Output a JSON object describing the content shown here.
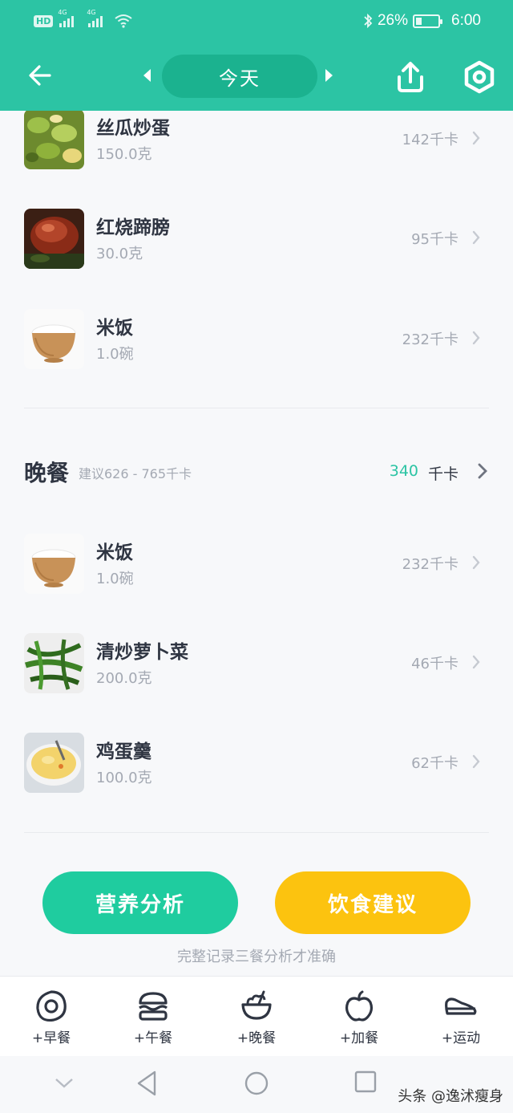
{
  "status_bar": {
    "hd": "HD",
    "net1": "4G",
    "net2": "4G",
    "battery_percent": "26%",
    "battery_level": 0.26,
    "time": "6:00"
  },
  "header": {
    "date_label": "今天",
    "back_icon": "arrow-left-icon",
    "prev_icon": "caret-left-icon",
    "next_icon": "caret-right-icon",
    "share_icon": "share-upload-icon",
    "settings_icon": "hexagon-settings-icon"
  },
  "lunch_items": [
    {
      "name": "丝瓜炒蛋",
      "qty": "150.0克",
      "kcal": "142千卡"
    },
    {
      "name": "红烧蹄膀",
      "qty": "30.0克",
      "kcal": "95千卡"
    },
    {
      "name": "米饭",
      "qty": "1.0碗",
      "kcal": "232千卡"
    }
  ],
  "dinner": {
    "title": "晚餐",
    "suggest": "建议626 - 765千卡",
    "kcal": "340",
    "kcal_unit": "千卡",
    "items": [
      {
        "name": "米饭",
        "qty": "1.0碗",
        "kcal": "232千卡"
      },
      {
        "name": "清炒萝卜菜",
        "qty": "200.0克",
        "kcal": "46千卡"
      },
      {
        "name": "鸡蛋羹",
        "qty": "100.0克",
        "kcal": "62千卡"
      }
    ]
  },
  "actions": {
    "nutrition_label": "营养分析",
    "diet_label": "饮食建议",
    "hint": "完整记录三餐分析才准确"
  },
  "tabs": [
    {
      "label": "+早餐",
      "icon": "egg-icon"
    },
    {
      "label": "+午餐",
      "icon": "burger-icon"
    },
    {
      "label": "+晚餐",
      "icon": "bowl-icon"
    },
    {
      "label": "+加餐",
      "icon": "apple-icon"
    },
    {
      "label": "+运动",
      "icon": "sneaker-icon"
    }
  ],
  "watermark": "头条 @逸沭瘦身",
  "colors": {
    "brand": "#2cc4a4",
    "green_button": "#1fcc9f",
    "yellow_button": "#fcc30f",
    "muted_text": "#a4a9b3"
  }
}
